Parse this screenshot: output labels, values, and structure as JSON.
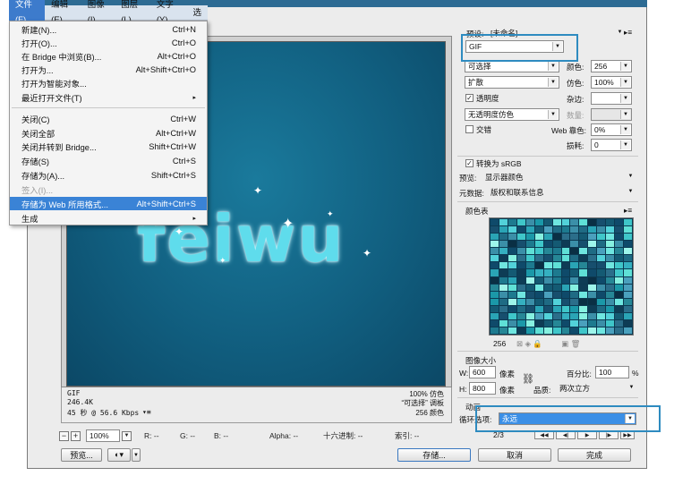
{
  "menubar": {
    "items": [
      {
        "label": "文件(F)",
        "active": true
      },
      {
        "label": "编辑(E)",
        "active": false
      },
      {
        "label": "图像(I)",
        "active": false
      },
      {
        "label": "图层(L)",
        "active": false
      },
      {
        "label": "文字(Y)",
        "active": false
      },
      {
        "label": "选",
        "active": false
      }
    ]
  },
  "file_menu": {
    "items": [
      {
        "label": "新建(N)...",
        "shortcut": "Ctrl+N"
      },
      {
        "label": "打开(O)...",
        "shortcut": "Ctrl+O"
      },
      {
        "label": "在 Bridge 中浏览(B)...",
        "shortcut": "Alt+Ctrl+O"
      },
      {
        "label": "打开为...",
        "shortcut": "Alt+Shift+Ctrl+O"
      },
      {
        "label": "打开为智能对象...",
        "shortcut": ""
      },
      {
        "label": "最近打开文件(T)",
        "shortcut": "▸"
      },
      {
        "label": "关闭(C)",
        "shortcut": "Ctrl+W"
      },
      {
        "label": "关闭全部",
        "shortcut": "Alt+Ctrl+W"
      },
      {
        "label": "关闭并转到 Bridge...",
        "shortcut": "Shift+Ctrl+W"
      },
      {
        "label": "存储(S)",
        "shortcut": "Ctrl+S"
      },
      {
        "label": "存储为(A)...",
        "shortcut": "Shift+Ctrl+S"
      },
      {
        "label": "签入(I)...",
        "shortcut": ""
      },
      {
        "label": "存储为 Web 所用格式...",
        "shortcut": "Alt+Shift+Ctrl+S"
      },
      {
        "label": "生成",
        "shortcut": "▸"
      }
    ]
  },
  "canvas": {
    "text": "feiwu"
  },
  "preview_info": {
    "format": "GIF",
    "size": "246.4K",
    "time": "45 秒 @ 56.6 Kbps",
    "menu_glyph": "▾≡",
    "quality": "100% 仿色",
    "palette": "“可选择” 调板",
    "colors": "256 颜色"
  },
  "statusbar": {
    "zoom": "100%",
    "r": "R: --",
    "g": "G: --",
    "b": "B: --",
    "alpha": "Alpha: --",
    "hex": "十六进制: --",
    "index": "索引: --"
  },
  "bottom_buttons": {
    "preview": "预览...",
    "save": "存储...",
    "cancel": "取消",
    "done": "完成"
  },
  "settings": {
    "preset_label": "预设:",
    "preset_value": "[未命名]",
    "format": "GIF",
    "reduction": "可选择",
    "colors_label": "颜色:",
    "colors_value": "256",
    "dither_algo": "扩散",
    "dither_label": "仿色:",
    "dither_value": "100%",
    "transparency": "透明度",
    "matte_label": "杂边:",
    "trans_dither": "无透明度仿色",
    "amount_label": "数量:",
    "interlaced": "交错",
    "web_snap_label": "Web 靠色:",
    "web_snap_value": "0%",
    "lossy_label": "损耗:",
    "lossy_value": "0",
    "convert_srgb": "转换为 sRGB",
    "preview_label": "预览:",
    "preview_value": "显示器颜色",
    "metadata_label": "元数据:",
    "metadata_value": "版权和联系信息",
    "color_table_title": "颜色表",
    "color_count": "256",
    "image_size_title": "图像大小",
    "w_label": "W:",
    "w_value": "600",
    "h_label": "H:",
    "h_value": "800",
    "px_unit": "像素",
    "percent_label": "百分比:",
    "percent_value": "100",
    "percent_unit": "%",
    "quality_label": "品质:",
    "quality_value": "两次立方",
    "animation_title": "动画",
    "loop_label": "循环选项:",
    "loop_value": "永远",
    "frame_counter": "2/3"
  }
}
